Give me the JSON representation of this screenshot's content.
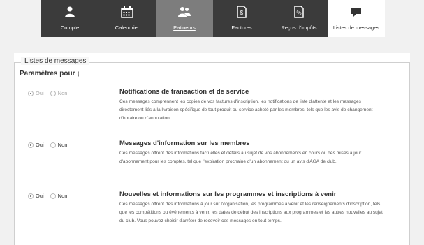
{
  "nav": {
    "tabs": [
      {
        "label": "Compte",
        "icon": "person-icon",
        "state": "normal"
      },
      {
        "label": "Calendrier",
        "icon": "calendar-icon",
        "state": "normal"
      },
      {
        "label": "Patineurs",
        "icon": "group-icon",
        "state": "active"
      },
      {
        "label": "Factures",
        "icon": "invoice-icon",
        "state": "normal"
      },
      {
        "label": "Reçus d'impôts",
        "icon": "percent-receipt-icon",
        "state": "normal"
      },
      {
        "label": "Listes de messages",
        "icon": "chat-icon",
        "state": "selected"
      }
    ]
  },
  "panel": {
    "legend": "Listes de messages",
    "subhead": "Paramètres pour ¡"
  },
  "sections": [
    {
      "yes_label": "Oui",
      "no_label": "Non",
      "selected": "Oui",
      "disabled": true,
      "title": "Notifications de transaction et de service",
      "desc": "Ces messages comprennent les copies de vos factures d'inscription, les notifications de liste d'attente et les messages directement liés à la livraison spécifique de tout produit ou service acheté par les membres, tels que les avis de changement d'horaire ou d'annulation."
    },
    {
      "yes_label": "Oui",
      "no_label": "Non",
      "selected": "Oui",
      "disabled": false,
      "title": "Messages d'information sur les membres",
      "desc": "Ces messages offrent des informations factuelles et détails au sujet de vos abonnements en cours ou des mises à jour d'abonnement pour les comptes, tel que l'expiration prochaine d'un abonnement ou un avis d'AGA de club."
    },
    {
      "yes_label": "Oui",
      "no_label": "Non",
      "selected": "Oui",
      "disabled": false,
      "title": "Nouvelles et informations sur les programmes et inscriptions à venir",
      "desc": "Ces messages offrent des informations à jour sur l'organisation, les programmes à venir et les renseignements d'inscription, tels que les compétitions ou événements à venir, les dates de début des inscriptions aux programmes et les autres nouvelles au sujet du club. Vous pouvez choisir d'arrêter de recevoir ces messages en tout temps."
    }
  ]
}
